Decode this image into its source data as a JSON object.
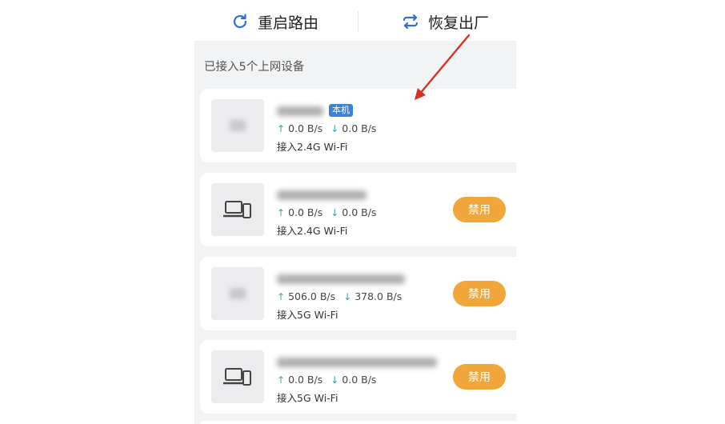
{
  "toolbar": {
    "restart_label": "重启路由",
    "reset_label": "恢复出厂",
    "accent_color": "#2f6fd6"
  },
  "devices_section": {
    "label": "已接入5个上网设备"
  },
  "devices": [
    {
      "icon": "blurred-icon",
      "is_self_badge": "本机",
      "up": "0.0 B/s",
      "down": "0.0 B/s",
      "connection": "接入2.4G Wi-Fi",
      "action": ""
    },
    {
      "icon": "laptop-phone-icon",
      "up": "0.0 B/s",
      "down": "0.0 B/s",
      "connection": "接入2.4G Wi-Fi",
      "action": "禁用"
    },
    {
      "icon": "blurred-icon",
      "up": "506.0 B/s",
      "down": "378.0 B/s",
      "connection": "接入5G Wi-Fi",
      "action": "禁用"
    },
    {
      "icon": "laptop-phone-icon",
      "up": "0.0 B/s",
      "down": "0.0 B/s",
      "connection": "接入5G Wi-Fi",
      "action": "禁用"
    }
  ],
  "colors": {
    "disable_button": "#f0a63a",
    "badge": "#3b82d6",
    "annotation_arrow": "#d93025"
  }
}
